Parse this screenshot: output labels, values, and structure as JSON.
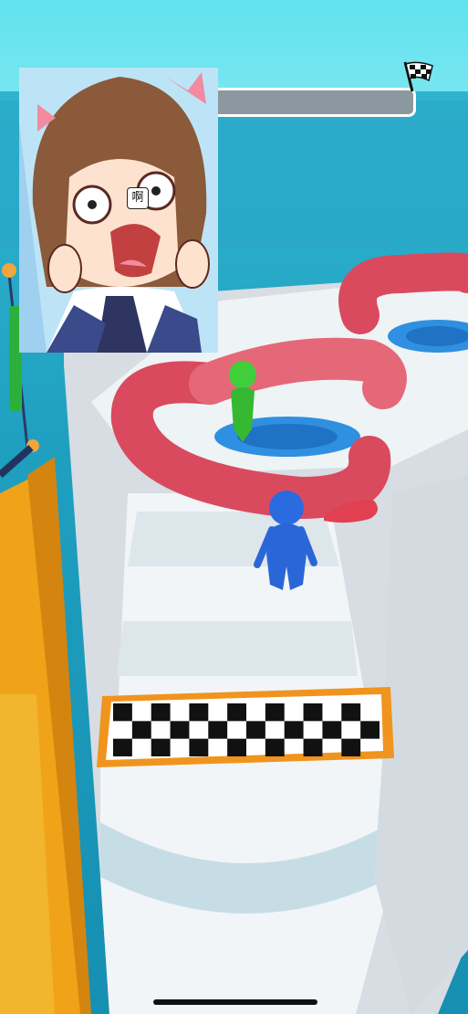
{
  "hud": {
    "progress": 0.0,
    "finish_icon": "checkered-flag-icon"
  },
  "reaction_sticker": {
    "text": "啊",
    "image": "shocked-anime-girl"
  },
  "colors": {
    "track": "#eef3f5",
    "ring": "#d94a5e",
    "player": "#2a6be0",
    "rival_green": "#3fcf3a",
    "rival_red": "#e04050",
    "finish_border": "#f0941e",
    "sea": "#1f9fc0"
  }
}
